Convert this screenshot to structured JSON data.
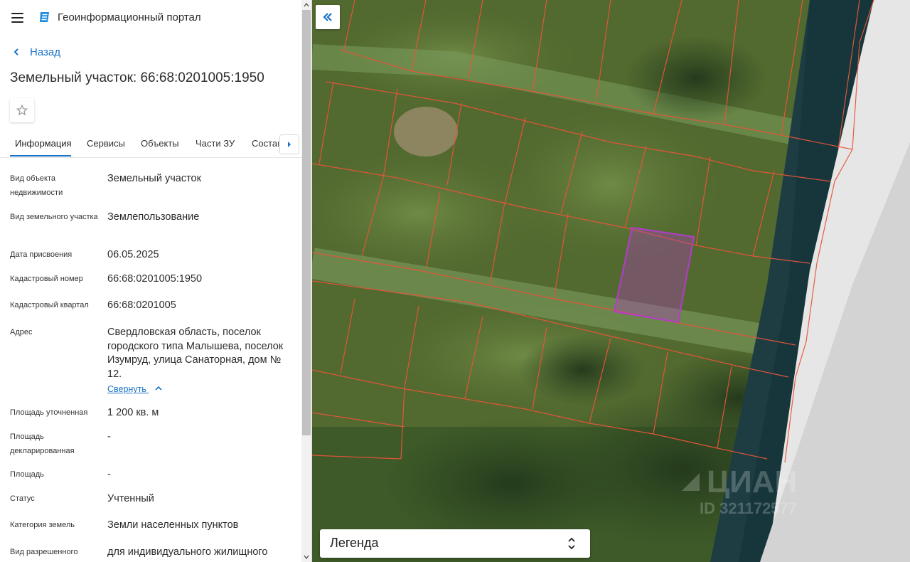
{
  "app": {
    "title": "Геоинформационный портал"
  },
  "nav": {
    "back_label": "Назад"
  },
  "page": {
    "title": "Земельный участок: 66:68:0201005:1950"
  },
  "tabs": [
    {
      "label": "Информация"
    },
    {
      "label": "Сервисы"
    },
    {
      "label": "Объекты"
    },
    {
      "label": "Части ЗУ"
    },
    {
      "label": "Состав"
    }
  ],
  "active_tab": "Информация",
  "info": {
    "rows": [
      {
        "label": "Вид объекта недвижимости",
        "value": "Земельный участок"
      },
      {
        "label": "Вид земельного участка",
        "value": "Землепользование"
      },
      {
        "label": "Дата присвоения",
        "value": "06.05.2025"
      },
      {
        "label": "Кадастровый номер",
        "value": "66:68:0201005:1950"
      },
      {
        "label": "Кадастровый квартал",
        "value": "66:68:0201005"
      },
      {
        "label": "Адрес",
        "value": "Свердловская область, поселок городского типа Малышева, поселок Изумруд, улица Санаторная, дом № 12."
      },
      {
        "label": "Площадь уточненная",
        "value": "1 200 кв. м"
      },
      {
        "label": "Площадь декларированная",
        "value": "-"
      },
      {
        "label": "Площадь",
        "value": "-"
      },
      {
        "label": "Статус",
        "value": "Учтенный"
      },
      {
        "label": "Категория земель",
        "value": "Земли населенных пунктов"
      },
      {
        "label": "Вид разрешенного",
        "value": "для индивидуального жилищного"
      }
    ],
    "collapse_label": "Свернуть"
  },
  "map": {
    "legend_label": "Легенда",
    "watermark": "ЦИАН",
    "watermark_id": "ID 321172577"
  },
  "colors": {
    "accent": "#1a73c8",
    "parcel_border": "#e8553a",
    "selected_parcel": "#b43cc8"
  },
  "icons": [
    "menu-icon",
    "portal-logo-icon",
    "chevron-left-icon",
    "star-icon",
    "caret-right-icon",
    "double-chevron-left-icon",
    "sort-icon"
  ]
}
